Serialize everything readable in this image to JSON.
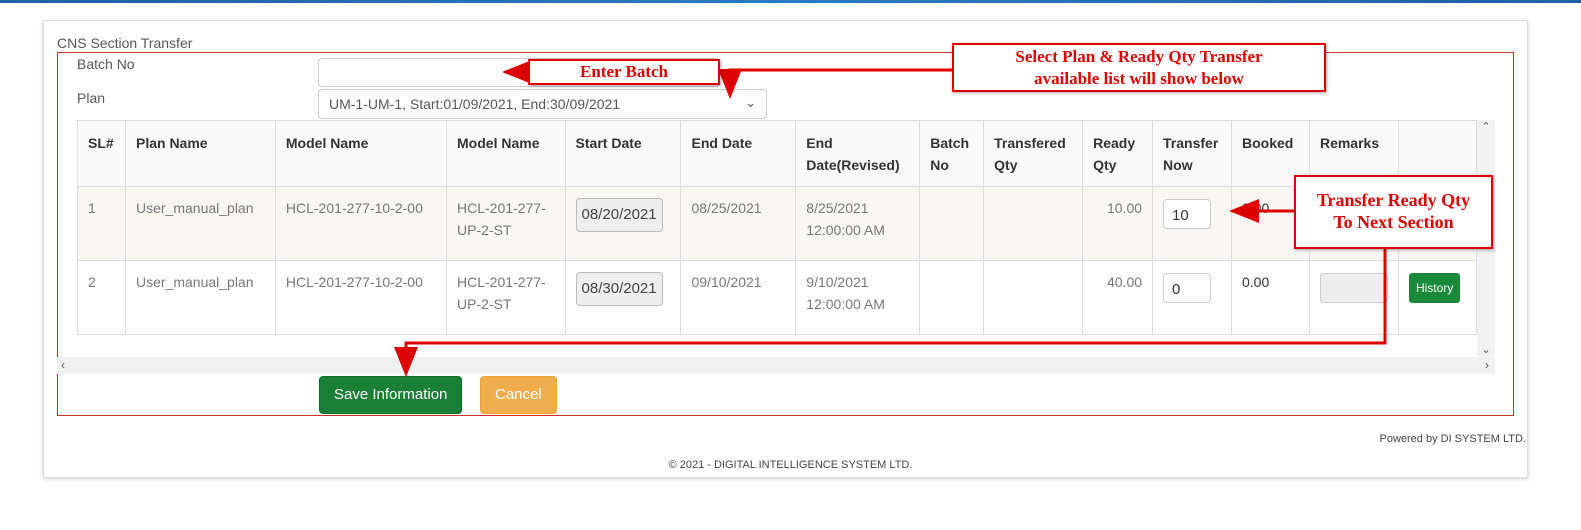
{
  "form": {
    "title": "CNS Section Transfer",
    "batch_label": "Batch No",
    "batch_value": "",
    "plan_label": "Plan",
    "plan_value": "UM-1-UM-1, Start:01/09/2021, End:30/09/2021"
  },
  "table": {
    "headers": [
      "SL#",
      "Plan Name",
      "Model Name",
      "Model Name",
      "Start Date",
      "End Date",
      "End Date(Revised)",
      "Batch No",
      "Transfered Qty",
      "Ready Qty",
      "Transfer Now",
      "Booked",
      "Remarks",
      ""
    ],
    "rows": [
      {
        "sl": "1",
        "plan": "User_manual_plan",
        "model1": "HCL-201-277-10-2-00",
        "model2": "HCL-201-277-UP-2-ST",
        "start": "08/20/2021",
        "end": "08/25/2021",
        "revised": "8/25/2021 12:00:00 AM",
        "batch": "",
        "transfered": "",
        "ready": "10.00",
        "now": "10",
        "booked": "0.00",
        "remarks": ""
      },
      {
        "sl": "2",
        "plan": "User_manual_plan",
        "model1": "HCL-201-277-10-2-00",
        "model2": "HCL-201-277-UP-2-ST",
        "start": "08/30/2021",
        "end": "09/10/2021",
        "revised": "9/10/2021 12:00:00 AM",
        "batch": "",
        "transfered": "",
        "ready": "40.00",
        "now": "0",
        "booked": "0.00",
        "remarks": "",
        "action": "History"
      }
    ]
  },
  "buttons": {
    "save": "Save Information",
    "cancel": "Cancel"
  },
  "footer": {
    "powered": "Powered by DI SYSTEM LTD.",
    "copyright": "© 2021 - DIGITAL INTELLIGENCE SYSTEM LTD."
  },
  "callouts": {
    "batch": "Enter Batch",
    "plan_line1": "Select Plan & Ready Qty Transfer",
    "plan_line2": "available list will show below",
    "transfer_line1": "Transfer Ready Qty",
    "transfer_line2": "To Next Section"
  },
  "colors": {
    "annotation": "#dd0000",
    "save": "#1a7f37",
    "cancel": "#f0ad4e",
    "history": "#1a8a3a"
  }
}
